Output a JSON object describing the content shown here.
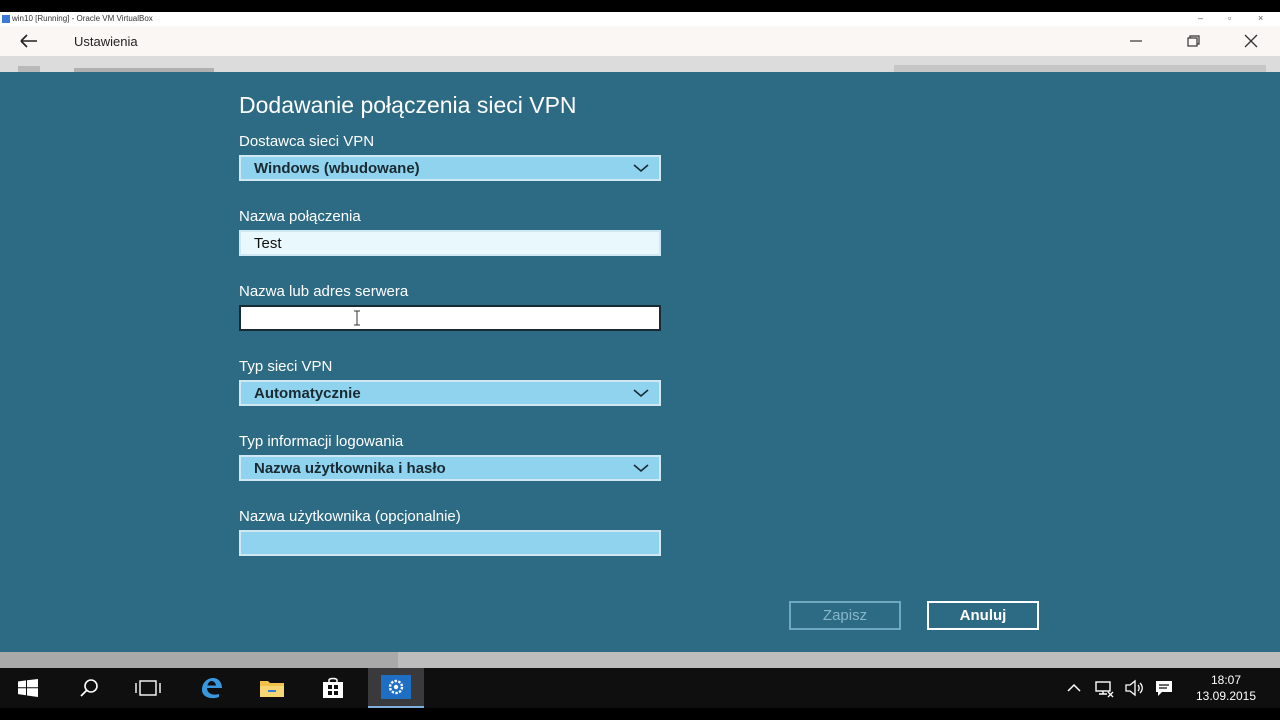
{
  "vbox": {
    "title": "win10 [Running] - Oracle VM VirtualBox"
  },
  "window": {
    "title": "Ustawienia"
  },
  "dialog": {
    "title": "Dodawanie połączenia sieci VPN",
    "fields": {
      "provider": {
        "label": "Dostawca sieci VPN",
        "value": "Windows (wbudowane)"
      },
      "connection_name": {
        "label": "Nazwa połączenia",
        "value": "Test"
      },
      "server": {
        "label": "Nazwa lub adres serwera",
        "value": ""
      },
      "vpn_type": {
        "label": "Typ sieci VPN",
        "value": "Automatycznie"
      },
      "signin_type": {
        "label": "Typ informacji logowania",
        "value": "Nazwa użytkownika i hasło"
      },
      "username": {
        "label": "Nazwa użytkownika (opcjonalnie)",
        "value": ""
      }
    },
    "buttons": {
      "save": "Zapisz",
      "cancel": "Anuluj"
    }
  },
  "taskbar": {
    "clock": {
      "time": "18:07",
      "date": "13.09.2015"
    },
    "icons": [
      "start-icon",
      "search-icon",
      "task-view-icon",
      "edge-icon",
      "file-explorer-icon",
      "store-icon",
      "settings-icon"
    ]
  },
  "colors": {
    "dialog_bg": "#2d6b85",
    "dropdown_bg": "#8fd3ef",
    "taskbar_bg": "#0f0f10"
  }
}
